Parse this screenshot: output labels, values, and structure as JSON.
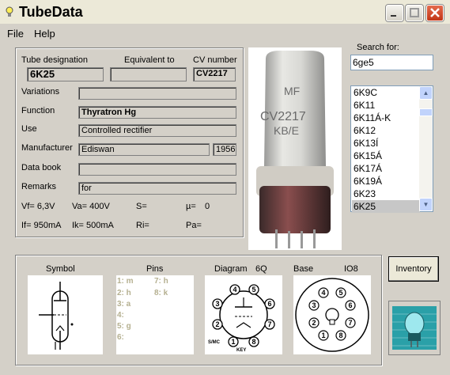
{
  "window": {
    "title": "TubeData"
  },
  "menu": {
    "file": "File",
    "help": "Help"
  },
  "headers": {
    "designation": "Tube designation",
    "equivalent": "Equivalent to",
    "cv": "CV number"
  },
  "tube": {
    "designation": "6K25",
    "equivalent": "",
    "cv_number": "CV2217",
    "variations_label": "Variations",
    "variations": "",
    "function_label": "Function",
    "function": "Thyratron Hg",
    "use_label": "Use",
    "use": "Controlled rectifier",
    "manufacturer_label": "Manufacturer",
    "manufacturer": "Ediswan",
    "year": "1956",
    "databook_label": "Data book",
    "databook": "",
    "remarks_label": "Remarks",
    "remarks": "for"
  },
  "specs": {
    "vf": "Vf= 6,3V",
    "va": "Va= 400V",
    "s": "S=",
    "mu": "µ=",
    "mu_val": "0",
    "if": "If= 950mA",
    "ik": "Ik= 500mA",
    "ri": "Ri=",
    "pa": "Pa="
  },
  "search": {
    "label": "Search for:",
    "value": "6ge5"
  },
  "list": {
    "items": [
      "6K9C",
      "6K11",
      "6K11Á-K",
      "6K12",
      "6K13Í",
      "6K15Á",
      "6K17Á",
      "6K19Á",
      "6K23",
      "6K25"
    ],
    "selected": "6K25"
  },
  "bottom": {
    "symbol_label": "Symbol",
    "pins_label": "Pins",
    "diagram_label": "Diagram",
    "diagram_code": "6Q",
    "base_label": "Base",
    "base_code": "IO8",
    "pins": [
      "1: m",
      "2: h",
      "3: a",
      "4:",
      "5: g",
      "6:",
      "7: h",
      "8: k"
    ],
    "diagram_text_left": "S/MC",
    "diagram_text_key": "KEY"
  },
  "photo": {
    "maker": "MF",
    "code": "CV2217",
    "sub": "KB/E"
  },
  "buttons": {
    "inventory": "Inventory"
  }
}
